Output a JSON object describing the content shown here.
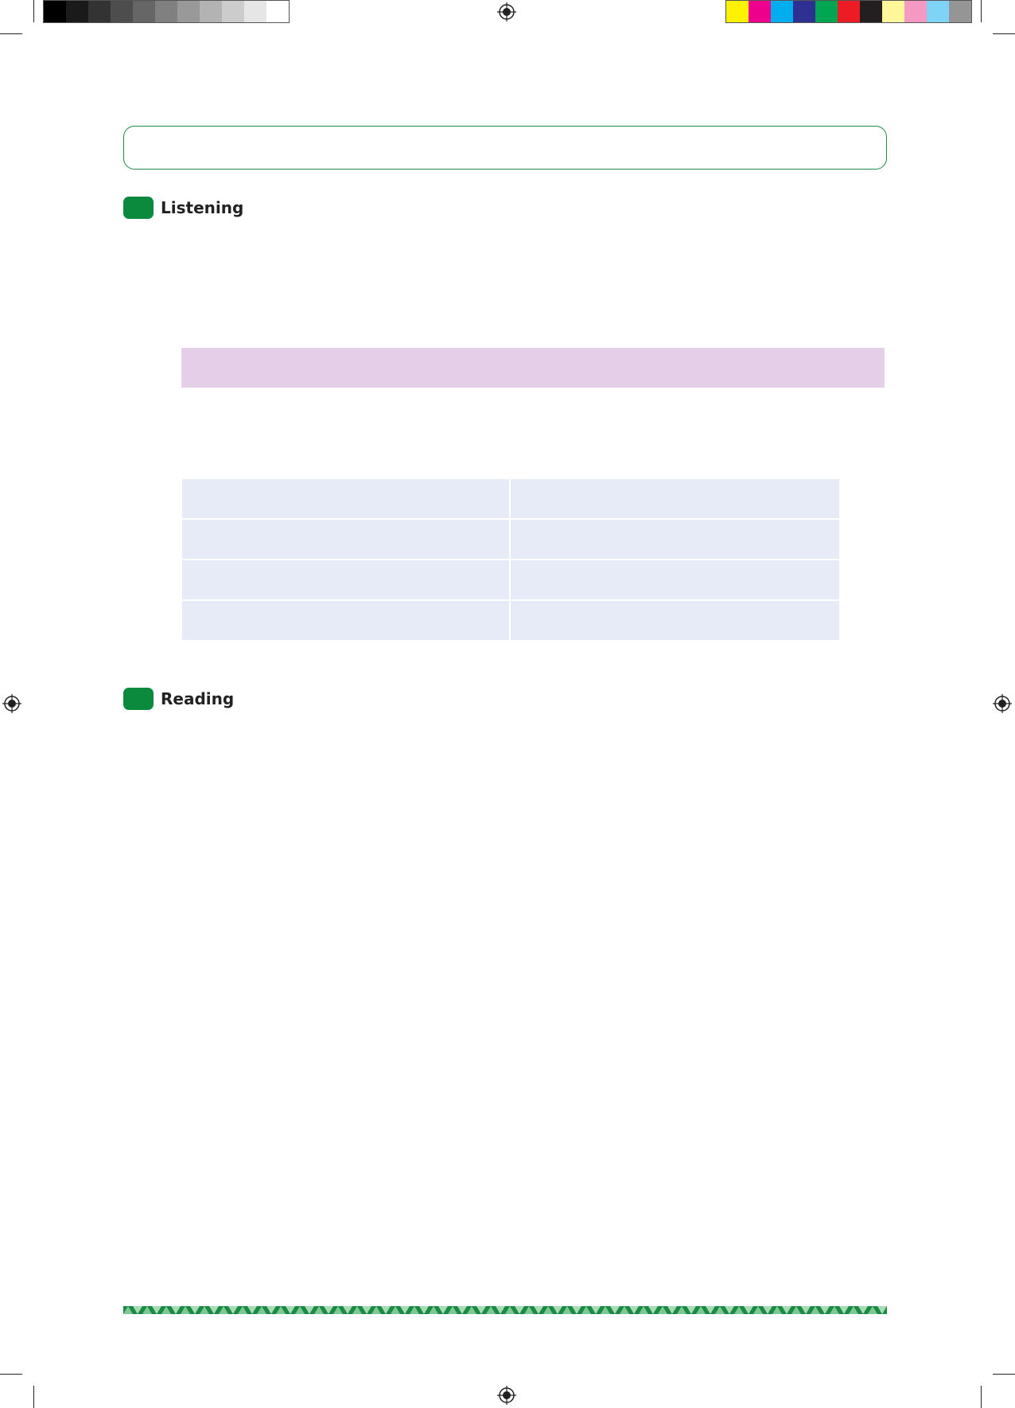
{
  "print_marks": {
    "grayscale_bar": [
      "#000000",
      "#1a1a1a",
      "#333333",
      "#4d4d4d",
      "#666666",
      "#808080",
      "#999999",
      "#b3b3b3",
      "#cccccc",
      "#e6e6e6",
      "#ffffff"
    ],
    "color_bar": [
      "#fff200",
      "#ec008c",
      "#00aeef",
      "#2e3192",
      "#00a651",
      "#ed1c24",
      "#231f20",
      "#fff799",
      "#f49ac2",
      "#7fd3f7",
      "#959595"
    ]
  },
  "colors": {
    "accent_green": "#0b8a3e",
    "title_border": "#1f8a43",
    "purple_band": "#e5cfe8",
    "table_cell": "#e6ebf7"
  },
  "sections": {
    "listening": {
      "title": "Listening"
    },
    "reading": {
      "title": "Reading"
    }
  },
  "table": {
    "rows": [
      [
        "",
        ""
      ],
      [
        "",
        ""
      ],
      [
        "",
        ""
      ],
      [
        "",
        ""
      ]
    ]
  }
}
